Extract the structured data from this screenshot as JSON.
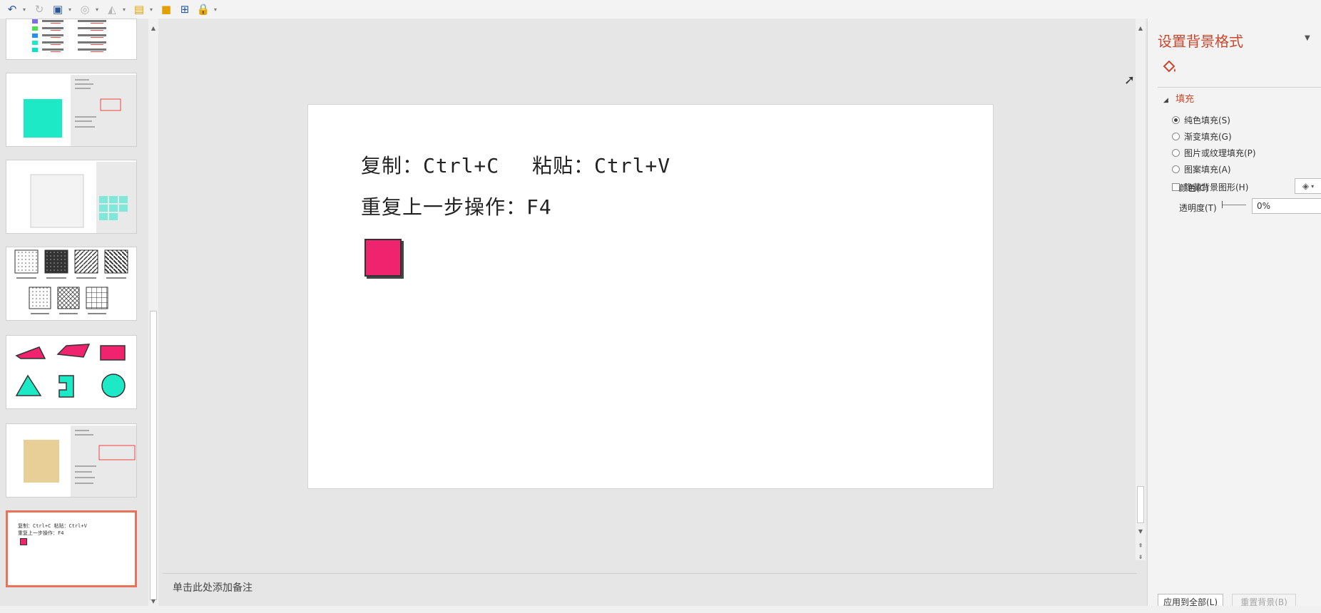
{
  "toolbar": {
    "icons": [
      "undo-icon",
      "redo-icon",
      "shapes-icon",
      "shape-fill-icon",
      "font-color-icon",
      "format-painter-icon",
      "new-slide-icon",
      "layout-icon",
      "lock-icon",
      "more-icon"
    ]
  },
  "slide_content": {
    "line1_copy": "复制：Ctrl+C",
    "line1_paste": "粘贴：Ctrl+V",
    "line2": "重复上一步操作：F4",
    "square_color": "#f0246e"
  },
  "thumbnail_mini": {
    "line1": "复制：Ctrl+C   粘贴：Ctrl+V",
    "line2": "重复上一步操作：F4"
  },
  "notes": {
    "placeholder": "单击此处添加备注"
  },
  "format_pane": {
    "title": "设置背景格式",
    "section": "填充",
    "options": [
      {
        "label": "纯色填充(S)",
        "checked": true
      },
      {
        "label": "渐变填充(G)",
        "checked": false
      },
      {
        "label": "图片或纹理填充(P)",
        "checked": false
      },
      {
        "label": "图案填充(A)",
        "checked": false
      }
    ],
    "hide_bg": "隐藏背景图形(H)",
    "color_label": "颜色(C)",
    "transparency_label": "透明度(T)",
    "transparency_value": "0%",
    "apply_all": "应用到全部(L)",
    "reset_bg": "重置背景(B)"
  },
  "colors": {
    "accent": "#c9472c",
    "selected_thumb_border": "#e8735a",
    "teal": "#1de9c6",
    "pink": "#f0246e",
    "tan": "#e8cf98"
  }
}
